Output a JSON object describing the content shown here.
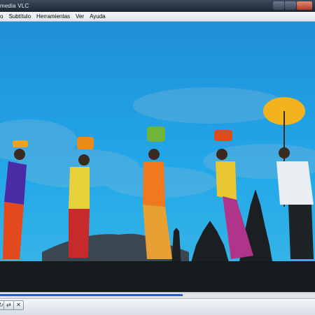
{
  "window": {
    "title": "media VLC"
  },
  "menu": {
    "items": [
      "o",
      "Subtítulo",
      "Herramientas",
      "Ver",
      "Ayuda"
    ]
  },
  "playback": {
    "progress_fraction": 0.58
  },
  "controls": {
    "loop_icon": "loop-icon",
    "playlist_icon": "shuffle-icon",
    "random_icon": "random-icon"
  },
  "colors": {
    "progress": "#2563c9",
    "sky": "#1fa3e0"
  }
}
